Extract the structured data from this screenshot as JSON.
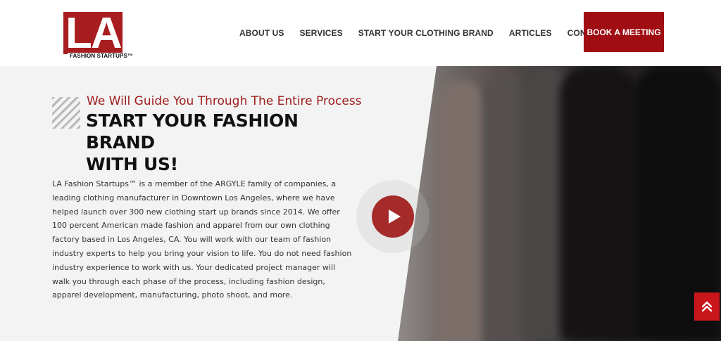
{
  "header": {
    "logo_letters": "LA",
    "logo_text": "FASHION STARTUPS™",
    "nav": [
      "ABOUT US",
      "SERVICES",
      "START YOUR CLOTHING BRAND",
      "ARTICLES",
      "CONTACT US"
    ],
    "cta_label": "BOOK A MEETING"
  },
  "hero": {
    "tagline": "We Will Guide You Through The Entire Process",
    "headline_line1": "START YOUR FASHION BRAND",
    "headline_line2": "WITH US!",
    "body": "LA Fashion Startups™ is a member of the ARGYLE family of companies, a leading clothing manufacturer in Downtown Los Angeles, where we have helped launch over 300 new clothing start up brands since 2014. We offer 100 percent American made fashion and apparel from our own clothing factory based in Los Angeles, CA. You will work with our team of fashion industry experts to help you bring your vision to life. You do not need fashion industry experience to work with us. Your dedicated project manager will walk you through each phase of the process, including fashion design, apparel development, manufacturing, photo shoot, and more."
  },
  "icons": {
    "play": "play-icon",
    "scroll_top": "double-chevron-up-icon"
  },
  "colors": {
    "brand_red": "#a00d13",
    "tagline_red": "#9e1b1b",
    "play_red": "#a52a2a"
  }
}
